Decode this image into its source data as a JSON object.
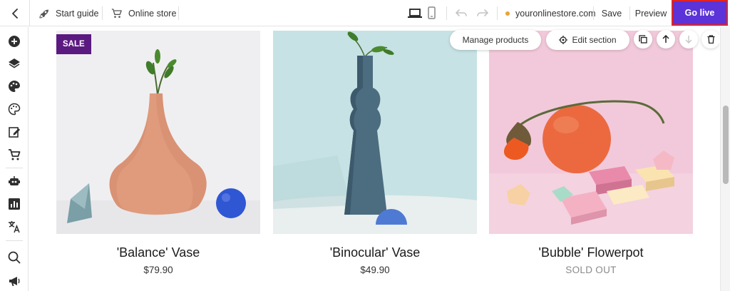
{
  "topbar": {
    "start_guide": "Start guide",
    "online_store": "Online store",
    "domain": "youronlinestore.com",
    "save": "Save",
    "preview": "Preview",
    "go_live": "Go live"
  },
  "section_toolbar": {
    "manage_products": "Manage products",
    "edit_section": "Edit section"
  },
  "products": [
    {
      "name": "'Balance' Vase",
      "price": "$79.90",
      "badge": "SALE"
    },
    {
      "name": "'Binocular' Vase",
      "price": "$49.90"
    },
    {
      "name": "'Bubble' Flowerpot",
      "price": "SOLD OUT"
    }
  ],
  "sidebar": {
    "icons": [
      "add-icon",
      "layers-icon",
      "palette-icon",
      "theme-icon",
      "edit-icon",
      "cart-icon",
      "bot-icon",
      "analytics-icon",
      "translate-icon",
      "search-icon",
      "megaphone-icon"
    ]
  },
  "colors": {
    "accent": "#5b33d9",
    "highlight_border": "#e02424",
    "sale_badge": "#5b1a80",
    "domain_dot": "#e8a33a"
  }
}
